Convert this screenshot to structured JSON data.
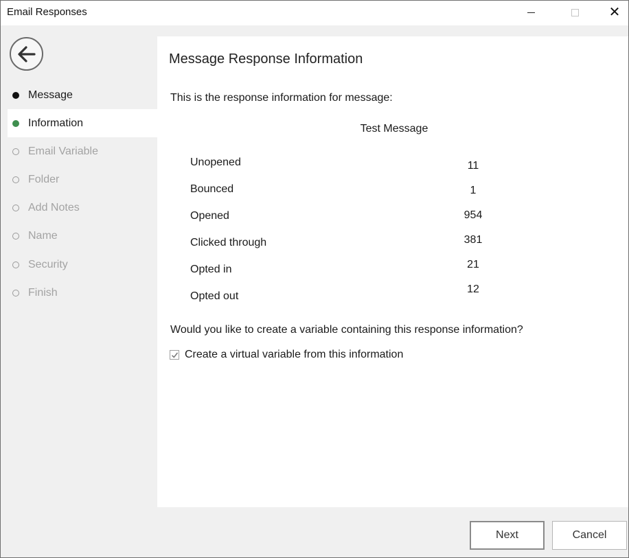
{
  "window": {
    "title": "Email Responses"
  },
  "sidebar": {
    "items": [
      {
        "label": "Message",
        "state": "done"
      },
      {
        "label": "Information",
        "state": "active"
      },
      {
        "label": "Email Variable",
        "state": "pending"
      },
      {
        "label": "Folder",
        "state": "pending"
      },
      {
        "label": "Add Notes",
        "state": "pending"
      },
      {
        "label": "Name",
        "state": "pending"
      },
      {
        "label": "Security",
        "state": "pending"
      },
      {
        "label": "Finish",
        "state": "pending"
      }
    ]
  },
  "main": {
    "title": "Message Response Information",
    "intro": "This is the response information for message:",
    "message_name": "Test Message",
    "stats": [
      {
        "label": "Unopened",
        "value": "11"
      },
      {
        "label": "Bounced",
        "value": "1"
      },
      {
        "label": "Opened",
        "value": "954"
      },
      {
        "label": "Clicked through",
        "value": "381"
      },
      {
        "label": "Opted in",
        "value": "21"
      },
      {
        "label": "Opted out",
        "value": "12"
      }
    ],
    "question": "Would you like to create a variable containing this response information?",
    "checkbox": {
      "label": "Create a virtual variable from this information",
      "checked": true
    }
  },
  "footer": {
    "next_label": "Next",
    "cancel_label": "Cancel"
  },
  "colors": {
    "active_dot": "#3f8f4f",
    "done_dot": "#111111",
    "background": "#f0f0f0"
  }
}
